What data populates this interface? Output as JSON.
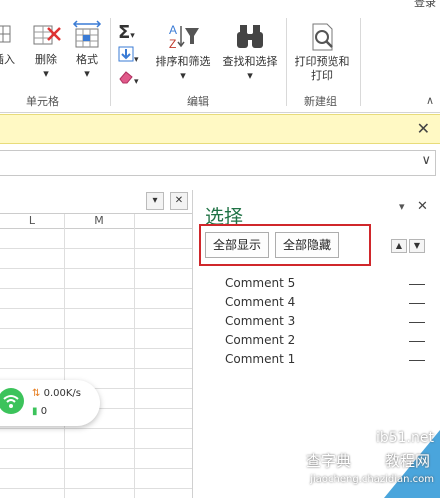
{
  "ribbon": {
    "signin": "登录",
    "insert_label": "插入",
    "delete_label": "删除",
    "format_label": "格式",
    "sort_filter_label": "排序和筛选",
    "find_select_label": "查找和选择",
    "print_label_line1": "打印预览和",
    "print_label_line2": "打印",
    "groups": {
      "cells": "单元格",
      "editing": "编辑",
      "new_group": "新建组"
    }
  },
  "sheet": {
    "columns": [
      "L",
      "M"
    ]
  },
  "wifi_widget": {
    "speed": "0.00K/s",
    "count": "0"
  },
  "selection_pane": {
    "title": "选择",
    "show_all": "全部显示",
    "hide_all": "全部隐藏",
    "items": [
      "Comment 5",
      "Comment 4",
      "Comment 3",
      "Comment 2",
      "Comment 1"
    ]
  },
  "watermark": {
    "line1": "ib51.net",
    "line2": "教程网",
    "line3": "jiaocheng.chazidian.com",
    "brand": "查字典"
  },
  "colors": {
    "accent_green": "#217346",
    "highlight_red": "#d0272b",
    "notice_yellow": "#fff9c4",
    "wifi_green": "#3cc35b"
  }
}
